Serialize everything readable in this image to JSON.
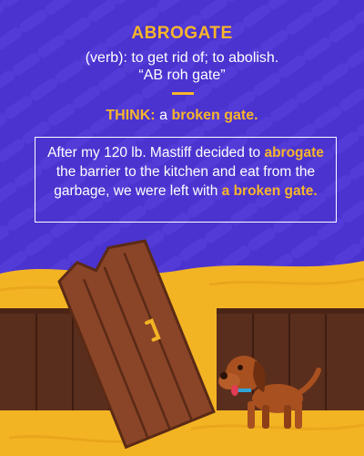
{
  "word": "ABROGATE",
  "definition": {
    "line1": "(verb): to get rid of; to abolish.",
    "line2": "“AB roh gate”"
  },
  "think": {
    "label": "THINK:",
    "prefix": "a",
    "phrase": "broken gate."
  },
  "example": {
    "part1": "After my 120 lb. Mastiff decided to",
    "highlight1": "abrogate",
    "part2": "the barrier to the kitchen and eat from the garbage, we were left with",
    "highlight2": "a broken gate."
  },
  "colors": {
    "background": "#4a33cf",
    "accent": "#f7b52b",
    "ground": "#f3b424",
    "fence": "#5a2e1c",
    "door": "#8a4427",
    "dog": "#a8501f"
  },
  "icons": [
    "broken-door",
    "dog"
  ]
}
